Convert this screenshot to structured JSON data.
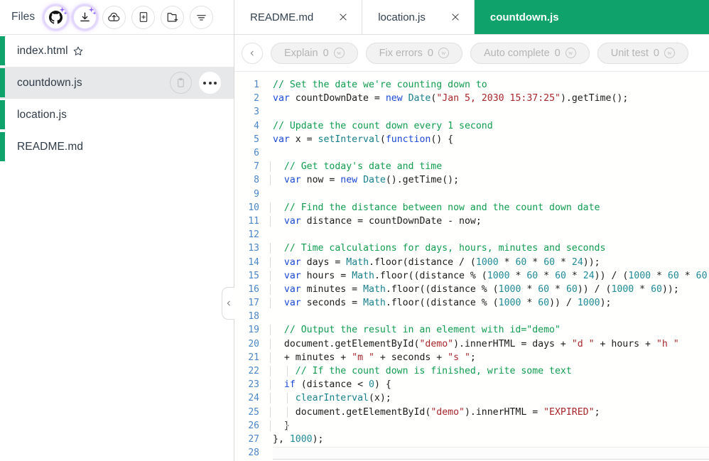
{
  "left_panel": {
    "title": "Files",
    "toolbar": [
      {
        "name": "github-icon",
        "label": "GitHub"
      },
      {
        "name": "download-icon",
        "label": "Download"
      },
      {
        "name": "cloud-upload-icon",
        "label": "Upload to cloud"
      },
      {
        "name": "new-file-icon",
        "label": "New file"
      },
      {
        "name": "new-folder-icon",
        "label": "New folder"
      },
      {
        "name": "filter-icon",
        "label": "Filter"
      }
    ],
    "files": [
      {
        "name": "index.html",
        "starred": true,
        "selected": false
      },
      {
        "name": "countdown.js",
        "starred": false,
        "selected": true
      },
      {
        "name": "location.js",
        "starred": false,
        "selected": false
      },
      {
        "name": "README.md",
        "starred": false,
        "selected": false
      }
    ],
    "row_actions": {
      "copy_label": "Copy",
      "menu_label": "More options"
    },
    "collapse_label": "Collapse panel"
  },
  "editor": {
    "tabs": [
      {
        "label": "README.md",
        "active": false,
        "closable": true
      },
      {
        "label": "location.js",
        "active": false,
        "closable": true
      },
      {
        "label": "countdown.js",
        "active": true,
        "closable": false
      }
    ],
    "back_label": "Back",
    "actions": [
      {
        "label": "Explain",
        "count": "0",
        "badge": "w",
        "disabled": true
      },
      {
        "label": "Fix errors",
        "count": "0",
        "badge": "w",
        "disabled": true
      },
      {
        "label": "Auto complete",
        "count": "0",
        "badge": "w",
        "disabled": true
      },
      {
        "label": "Unit test",
        "count": "0",
        "badge": "w",
        "disabled": true
      }
    ],
    "colors": {
      "accent_green": "#0fa36b",
      "comment": "#0f9c4e",
      "keyword": "#1b49d6",
      "number": "#1f8a96",
      "string": "#a8262b",
      "function": "#18808c",
      "line_number": "#4a86c8"
    },
    "code": {
      "language": "javascript",
      "filename": "countdown.js",
      "total_lines": 28,
      "lines": [
        {
          "n": "1",
          "guide": 0,
          "tokens": [
            {
              "t": "com",
              "v": "// Set the date we're counting down to"
            }
          ]
        },
        {
          "n": "2",
          "guide": 0,
          "tokens": [
            {
              "t": "kw",
              "v": "var"
            },
            {
              "t": "pl",
              "v": " countDownDate = "
            },
            {
              "t": "kw",
              "v": "new"
            },
            {
              "t": "pl",
              "v": " "
            },
            {
              "t": "fn",
              "v": "Date"
            },
            {
              "t": "pl",
              "v": "("
            },
            {
              "t": "str",
              "v": "\"Jan 5, 2030 15:37:25\""
            },
            {
              "t": "pl",
              "v": ").getTime();"
            }
          ]
        },
        {
          "n": "3",
          "guide": 0,
          "tokens": []
        },
        {
          "n": "4",
          "guide": 0,
          "tokens": [
            {
              "t": "com",
              "v": "// Update the count down every 1 second"
            }
          ]
        },
        {
          "n": "5",
          "guide": 0,
          "tokens": [
            {
              "t": "kw",
              "v": "var"
            },
            {
              "t": "pl",
              "v": " x = "
            },
            {
              "t": "fn",
              "v": "setInterval"
            },
            {
              "t": "pl",
              "v": "("
            },
            {
              "t": "kw",
              "v": "function"
            },
            {
              "t": "pl",
              "v": "() {"
            }
          ]
        },
        {
          "n": "6",
          "guide": 1,
          "tokens": []
        },
        {
          "n": "7",
          "guide": 1,
          "tokens": [
            {
              "t": "com",
              "v": "  // Get today's date and time"
            }
          ]
        },
        {
          "n": "8",
          "guide": 1,
          "tokens": [
            {
              "t": "pl",
              "v": "  "
            },
            {
              "t": "kw",
              "v": "var"
            },
            {
              "t": "pl",
              "v": " now = "
            },
            {
              "t": "kw",
              "v": "new"
            },
            {
              "t": "pl",
              "v": " "
            },
            {
              "t": "fn",
              "v": "Date"
            },
            {
              "t": "pl",
              "v": "().getTime();"
            }
          ]
        },
        {
          "n": "9",
          "guide": 1,
          "tokens": []
        },
        {
          "n": "10",
          "guide": 1,
          "tokens": [
            {
              "t": "com",
              "v": "  // Find the distance between now and the count down date"
            }
          ]
        },
        {
          "n": "11",
          "guide": 1,
          "tokens": [
            {
              "t": "pl",
              "v": "  "
            },
            {
              "t": "kw",
              "v": "var"
            },
            {
              "t": "pl",
              "v": " distance = countDownDate - now;"
            }
          ]
        },
        {
          "n": "12",
          "guide": 1,
          "tokens": []
        },
        {
          "n": "13",
          "guide": 1,
          "tokens": [
            {
              "t": "com",
              "v": "  // Time calculations for days, hours, minutes and seconds"
            }
          ]
        },
        {
          "n": "14",
          "guide": 1,
          "tokens": [
            {
              "t": "pl",
              "v": "  "
            },
            {
              "t": "kw",
              "v": "var"
            },
            {
              "t": "pl",
              "v": " days = "
            },
            {
              "t": "fn",
              "v": "Math"
            },
            {
              "t": "pl",
              "v": ".floor(distance / ("
            },
            {
              "t": "num",
              "v": "1000"
            },
            {
              "t": "pl",
              "v": " * "
            },
            {
              "t": "num",
              "v": "60"
            },
            {
              "t": "pl",
              "v": " * "
            },
            {
              "t": "num",
              "v": "60"
            },
            {
              "t": "pl",
              "v": " * "
            },
            {
              "t": "num",
              "v": "24"
            },
            {
              "t": "pl",
              "v": "));"
            }
          ]
        },
        {
          "n": "15",
          "guide": 1,
          "tokens": [
            {
              "t": "pl",
              "v": "  "
            },
            {
              "t": "kw",
              "v": "var"
            },
            {
              "t": "pl",
              "v": " hours = "
            },
            {
              "t": "fn",
              "v": "Math"
            },
            {
              "t": "pl",
              "v": ".floor((distance % ("
            },
            {
              "t": "num",
              "v": "1000"
            },
            {
              "t": "pl",
              "v": " * "
            },
            {
              "t": "num",
              "v": "60"
            },
            {
              "t": "pl",
              "v": " * "
            },
            {
              "t": "num",
              "v": "60"
            },
            {
              "t": "pl",
              "v": " * "
            },
            {
              "t": "num",
              "v": "24"
            },
            {
              "t": "pl",
              "v": ")) / ("
            },
            {
              "t": "num",
              "v": "1000"
            },
            {
              "t": "pl",
              "v": " * "
            },
            {
              "t": "num",
              "v": "60"
            },
            {
              "t": "pl",
              "v": " * "
            },
            {
              "t": "num",
              "v": "60"
            },
            {
              "t": "pl",
              "v": "));"
            }
          ]
        },
        {
          "n": "16",
          "guide": 1,
          "tokens": [
            {
              "t": "pl",
              "v": "  "
            },
            {
              "t": "kw",
              "v": "var"
            },
            {
              "t": "pl",
              "v": " minutes = "
            },
            {
              "t": "fn",
              "v": "Math"
            },
            {
              "t": "pl",
              "v": ".floor((distance % ("
            },
            {
              "t": "num",
              "v": "1000"
            },
            {
              "t": "pl",
              "v": " * "
            },
            {
              "t": "num",
              "v": "60"
            },
            {
              "t": "pl",
              "v": " * "
            },
            {
              "t": "num",
              "v": "60"
            },
            {
              "t": "pl",
              "v": ")) / ("
            },
            {
              "t": "num",
              "v": "1000"
            },
            {
              "t": "pl",
              "v": " * "
            },
            {
              "t": "num",
              "v": "60"
            },
            {
              "t": "pl",
              "v": "));"
            }
          ]
        },
        {
          "n": "17",
          "guide": 1,
          "tokens": [
            {
              "t": "pl",
              "v": "  "
            },
            {
              "t": "kw",
              "v": "var"
            },
            {
              "t": "pl",
              "v": " seconds = "
            },
            {
              "t": "fn",
              "v": "Math"
            },
            {
              "t": "pl",
              "v": ".floor((distance % ("
            },
            {
              "t": "num",
              "v": "1000"
            },
            {
              "t": "pl",
              "v": " * "
            },
            {
              "t": "num",
              "v": "60"
            },
            {
              "t": "pl",
              "v": ")) / "
            },
            {
              "t": "num",
              "v": "1000"
            },
            {
              "t": "pl",
              "v": ");"
            }
          ]
        },
        {
          "n": "18",
          "guide": 1,
          "tokens": []
        },
        {
          "n": "19",
          "guide": 1,
          "tokens": [
            {
              "t": "com",
              "v": "  // Output the result in an element with id=\"demo\""
            }
          ]
        },
        {
          "n": "20",
          "guide": 1,
          "tokens": [
            {
              "t": "pl",
              "v": "  document.getElementById("
            },
            {
              "t": "str",
              "v": "\"demo\""
            },
            {
              "t": "pl",
              "v": ").innerHTML = days + "
            },
            {
              "t": "str",
              "v": "\"d \""
            },
            {
              "t": "pl",
              "v": " + hours + "
            },
            {
              "t": "str",
              "v": "\"h \""
            }
          ]
        },
        {
          "n": "21",
          "guide": 1,
          "tokens": [
            {
              "t": "pl",
              "v": "  + minutes + "
            },
            {
              "t": "str",
              "v": "\"m \""
            },
            {
              "t": "pl",
              "v": " + seconds + "
            },
            {
              "t": "str",
              "v": "\"s \""
            },
            {
              "t": "pl",
              "v": ";"
            }
          ]
        },
        {
          "n": "22",
          "guide": 2,
          "tokens": [
            {
              "t": "com",
              "v": "    // If the count down is finished, write some text"
            }
          ]
        },
        {
          "n": "23",
          "guide": 1,
          "tokens": [
            {
              "t": "pl",
              "v": "  "
            },
            {
              "t": "kw",
              "v": "if"
            },
            {
              "t": "pl",
              "v": " (distance < "
            },
            {
              "t": "num",
              "v": "0"
            },
            {
              "t": "pl",
              "v": ") {"
            }
          ]
        },
        {
          "n": "24",
          "guide": 2,
          "tokens": [
            {
              "t": "pl",
              "v": "    "
            },
            {
              "t": "fn",
              "v": "clearInterval"
            },
            {
              "t": "pl",
              "v": "(x);"
            }
          ]
        },
        {
          "n": "25",
          "guide": 2,
          "tokens": [
            {
              "t": "pl",
              "v": "    document.getElementById("
            },
            {
              "t": "str",
              "v": "\"demo\""
            },
            {
              "t": "pl",
              "v": ").innerHTML = "
            },
            {
              "t": "str",
              "v": "\"EXPIRED\""
            },
            {
              "t": "pl",
              "v": ";"
            }
          ]
        },
        {
          "n": "26",
          "guide": 2,
          "tokens": [
            {
              "t": "pl",
              "v": "  }"
            }
          ]
        },
        {
          "n": "27",
          "guide": 0,
          "tokens": [
            {
              "t": "pl",
              "v": "}, "
            },
            {
              "t": "num",
              "v": "1000"
            },
            {
              "t": "pl",
              "v": ");"
            }
          ]
        },
        {
          "n": "28",
          "guide": 0,
          "tokens": [],
          "caret": true
        }
      ]
    }
  }
}
